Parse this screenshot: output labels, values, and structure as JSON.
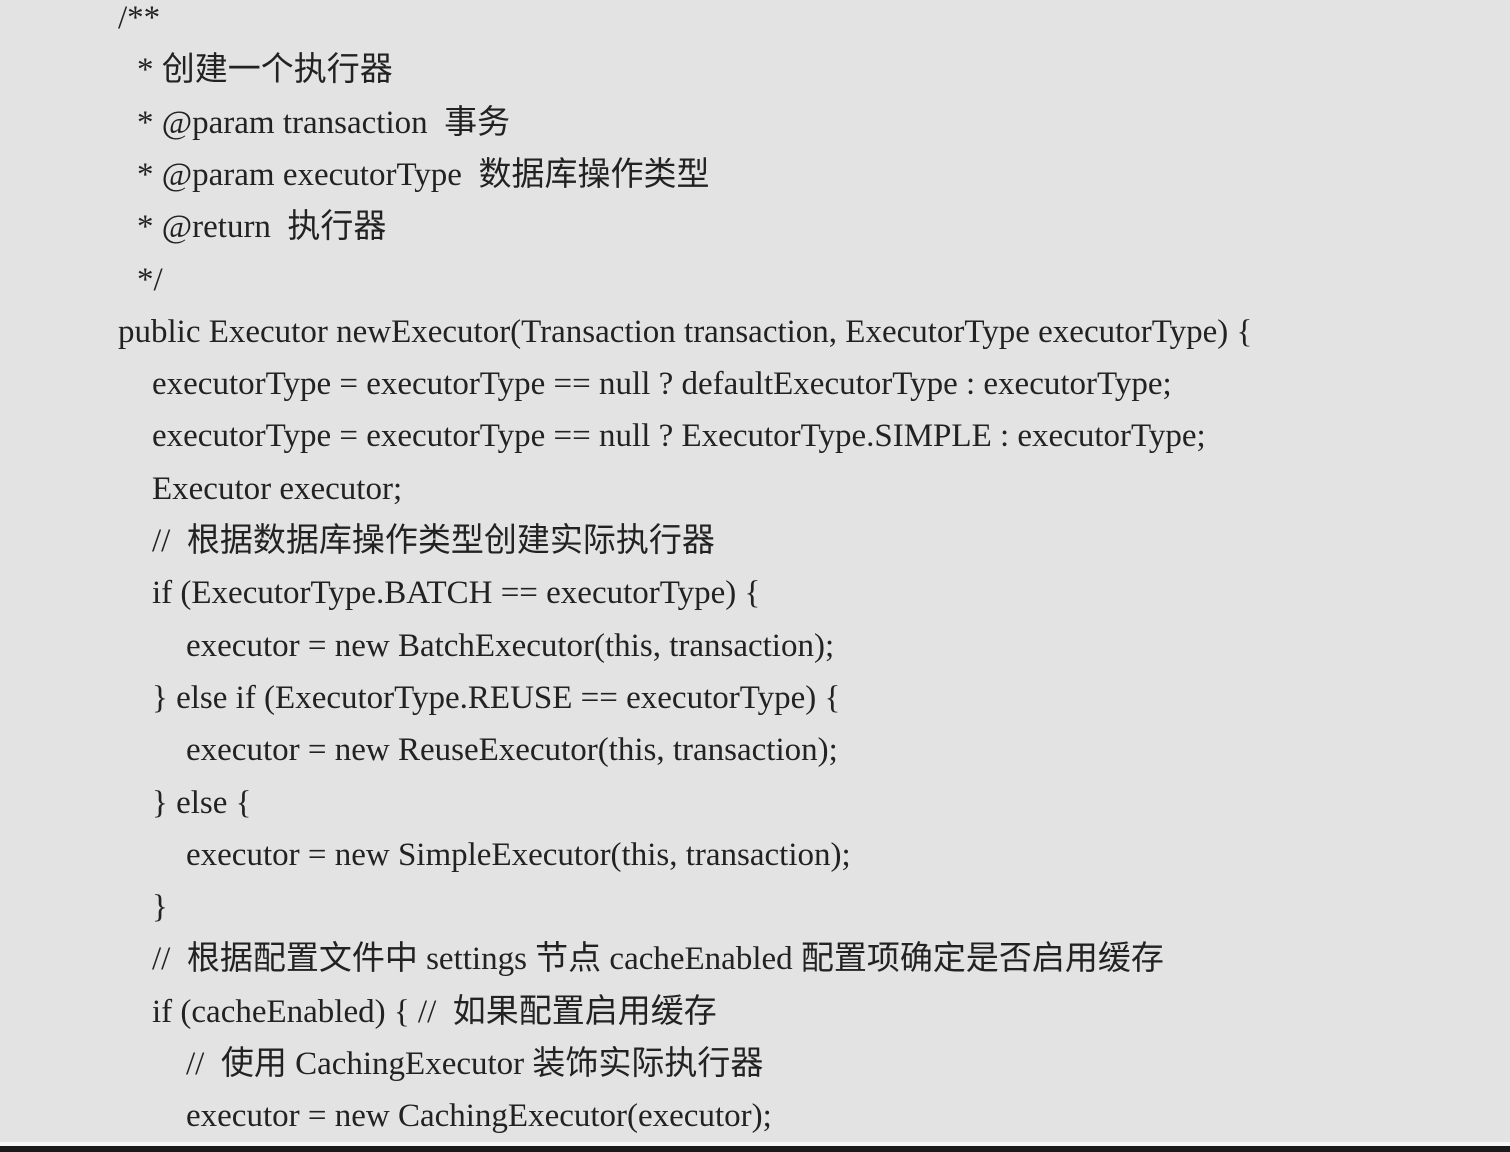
{
  "code_lines": [
    {
      "indent": 0,
      "text": "/**"
    },
    {
      "indent": "c",
      "text": "* 创建一个执行器"
    },
    {
      "indent": "c",
      "text": "* @param transaction  事务"
    },
    {
      "indent": "c",
      "text": "* @param executorType  数据库操作类型"
    },
    {
      "indent": "c",
      "text": "* @return  执行器"
    },
    {
      "indent": "c",
      "text": "*/"
    },
    {
      "indent": 0,
      "text": "public Executor newExecutor(Transaction transaction, ExecutorType executorType) {"
    },
    {
      "indent": 1,
      "text": "executorType = executorType == null ? defaultExecutorType : executorType;"
    },
    {
      "indent": 1,
      "text": "executorType = executorType == null ? ExecutorType.SIMPLE : executorType;"
    },
    {
      "indent": 1,
      "text": "Executor executor;"
    },
    {
      "indent": 1,
      "text": "//  根据数据库操作类型创建实际执行器"
    },
    {
      "indent": 1,
      "text": "if (ExecutorType.BATCH == executorType) {"
    },
    {
      "indent": 2,
      "text": "executor = new BatchExecutor(this, transaction);"
    },
    {
      "indent": 1,
      "text": "} else if (ExecutorType.REUSE == executorType) {"
    },
    {
      "indent": 2,
      "text": "executor = new ReuseExecutor(this, transaction);"
    },
    {
      "indent": 1,
      "text": "} else {"
    },
    {
      "indent": 2,
      "text": "executor = new SimpleExecutor(this, transaction);"
    },
    {
      "indent": 1,
      "text": "}"
    },
    {
      "indent": 1,
      "text": "//  根据配置文件中 settings 节点 cacheEnabled 配置项确定是否启用缓存"
    },
    {
      "indent": 1,
      "text": "if (cacheEnabled) { //  如果配置启用缓存"
    },
    {
      "indent": 2,
      "text": "//  使用 CachingExecutor 装饰实际执行器"
    },
    {
      "indent": 2,
      "text": "executor = new CachingExecutor(executor);"
    }
  ]
}
